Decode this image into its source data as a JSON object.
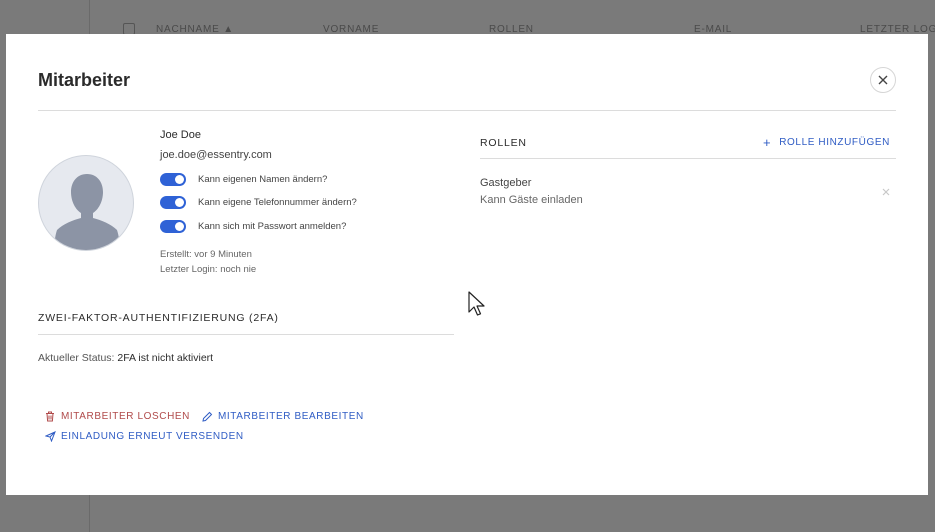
{
  "background": {
    "columns": [
      "NACHNAME ▲",
      "VORNAME",
      "ROLLEN",
      "E-MAIL",
      "LETZTER LOG"
    ]
  },
  "modal": {
    "title": "Mitarbeiter",
    "close_icon": "close-icon"
  },
  "user": {
    "name": "Joe Doe",
    "email": "joe.doe@essentry.com",
    "toggles": [
      {
        "label": "Kann eigenen Namen ändern?",
        "on": true
      },
      {
        "label": "Kann eigene Telefonnummer ändern?",
        "on": true
      },
      {
        "label": "Kann sich mit Passwort anmelden?",
        "on": true
      }
    ],
    "created": "Erstellt: vor 9 Minuten",
    "last_login": "Letzter Login: noch nie"
  },
  "twofa": {
    "heading": "ZWEI-FAKTOR-AUTHENTIFIZIERUNG (2FA)",
    "status_label": "Aktueller Status:",
    "status_value": "2FA ist nicht aktiviert"
  },
  "actions": {
    "delete": "MITARBEITER LOSCHEN",
    "edit": "MITARBEITER BEARBEITEN",
    "resend": "EINLADUNG ERNEUT VERSENDEN"
  },
  "roles": {
    "heading": "ROLLEN",
    "add_label": "ROLLE HINZUFÜGEN",
    "items": [
      {
        "name": "Gastgeber",
        "description": "Kann Gäste einladen"
      }
    ]
  },
  "colors": {
    "accent": "#2f62d6",
    "danger": "#b04a4a",
    "link": "#2f5cc4"
  }
}
